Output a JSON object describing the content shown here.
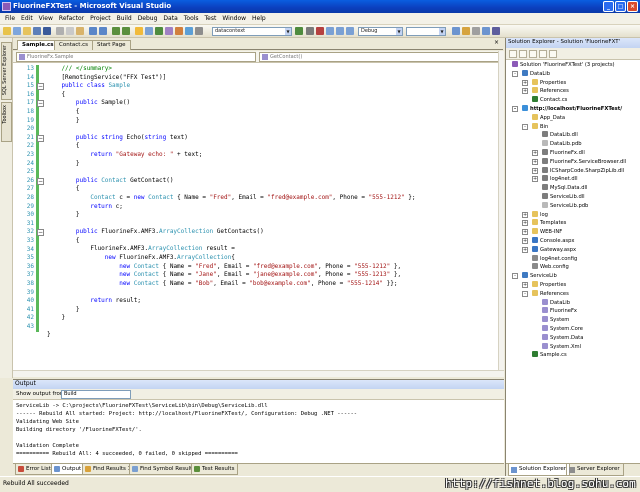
{
  "window": {
    "title": "FluorineFXTest - Microsoft Visual Studio"
  },
  "menu": [
    "File",
    "Edit",
    "View",
    "Refactor",
    "Project",
    "Build",
    "Debug",
    "Data",
    "Tools",
    "Test",
    "Window",
    "Help"
  ],
  "toolbar": {
    "combo1": "datacontext",
    "combo2": "Debug",
    "combo3": ""
  },
  "left_tabs": [
    "SQL Server Explorer",
    "Toolbox"
  ],
  "doc_tabs": [
    "Sample.cs",
    "Contact.cs",
    "Start Page"
  ],
  "nav": {
    "left": "FluorineFx.Sample",
    "right": "GetContact()"
  },
  "editor": {
    "line_numbers": [
      "13",
      "14",
      "15",
      "16",
      "17",
      "18",
      "19",
      "20",
      "21",
      "22",
      "23",
      "24",
      "25",
      "26",
      "27",
      "28",
      "29",
      "30",
      "31",
      "32",
      "33",
      "34",
      "35",
      "36",
      "37",
      "38",
      "39",
      "40",
      "41",
      "42",
      "43"
    ],
    "lines": [
      [
        {
          "t": "    /// </summary>",
          "c": "cm"
        }
      ],
      [
        {
          "t": "    [RemotingService(\"FFX Test\")]",
          "c": ""
        }
      ],
      [
        {
          "t": "    public ",
          "c": "kw"
        },
        {
          "t": "class ",
          "c": "kw"
        },
        {
          "t": "Sample",
          "c": "ty"
        }
      ],
      [
        {
          "t": "    {",
          "c": ""
        }
      ],
      [
        {
          "t": "        public ",
          "c": "kw"
        },
        {
          "t": "Sample()",
          "c": ""
        }
      ],
      [
        {
          "t": "        {",
          "c": ""
        }
      ],
      [
        {
          "t": "        }",
          "c": ""
        }
      ],
      [
        {
          "t": "",
          "c": ""
        }
      ],
      [
        {
          "t": "        public ",
          "c": "kw"
        },
        {
          "t": "string ",
          "c": "kw"
        },
        {
          "t": "Echo(",
          "c": ""
        },
        {
          "t": "string ",
          "c": "kw"
        },
        {
          "t": "text)",
          "c": ""
        }
      ],
      [
        {
          "t": "        {",
          "c": ""
        }
      ],
      [
        {
          "t": "            return ",
          "c": "kw"
        },
        {
          "t": "\"Gateway echo: \"",
          "c": "str"
        },
        {
          "t": " + text;",
          "c": ""
        }
      ],
      [
        {
          "t": "        }",
          "c": ""
        }
      ],
      [
        {
          "t": "",
          "c": ""
        }
      ],
      [
        {
          "t": "        public ",
          "c": "kw"
        },
        {
          "t": "Contact ",
          "c": "ty"
        },
        {
          "t": "GetContact()",
          "c": ""
        }
      ],
      [
        {
          "t": "        {",
          "c": ""
        }
      ],
      [
        {
          "t": "            Contact ",
          "c": "ty"
        },
        {
          "t": "c = ",
          "c": ""
        },
        {
          "t": "new ",
          "c": "kw"
        },
        {
          "t": "Contact ",
          "c": "ty"
        },
        {
          "t": "{ Name = ",
          "c": ""
        },
        {
          "t": "\"Fred\"",
          "c": "str"
        },
        {
          "t": ", Email = ",
          "c": ""
        },
        {
          "t": "\"fred@example.com\"",
          "c": "str"
        },
        {
          "t": ", Phone = ",
          "c": ""
        },
        {
          "t": "\"555-1212\"",
          "c": "str"
        },
        {
          "t": " };",
          "c": ""
        }
      ],
      [
        {
          "t": "            return ",
          "c": "kw"
        },
        {
          "t": "c;",
          "c": ""
        }
      ],
      [
        {
          "t": "        }",
          "c": ""
        }
      ],
      [
        {
          "t": "",
          "c": ""
        }
      ],
      [
        {
          "t": "        public ",
          "c": "kw"
        },
        {
          "t": "FluorineFx.AMF3.",
          "c": ""
        },
        {
          "t": "ArrayCollection ",
          "c": "ty"
        },
        {
          "t": "GetContacts()",
          "c": ""
        }
      ],
      [
        {
          "t": "        {",
          "c": ""
        }
      ],
      [
        {
          "t": "            FluorineFx.AMF3.",
          "c": ""
        },
        {
          "t": "ArrayCollection ",
          "c": "ty"
        },
        {
          "t": "result =",
          "c": ""
        }
      ],
      [
        {
          "t": "                new ",
          "c": "kw"
        },
        {
          "t": "FluorineFx.AMF3.",
          "c": ""
        },
        {
          "t": "ArrayCollection",
          "c": "ty"
        },
        {
          "t": "{",
          "c": ""
        }
      ],
      [
        {
          "t": "                    new ",
          "c": "kw"
        },
        {
          "t": "Contact ",
          "c": "ty"
        },
        {
          "t": "{ Name = ",
          "c": ""
        },
        {
          "t": "\"Fred\"",
          "c": "str"
        },
        {
          "t": ", Email = ",
          "c": ""
        },
        {
          "t": "\"fred@example.com\"",
          "c": "str"
        },
        {
          "t": ", Phone = ",
          "c": ""
        },
        {
          "t": "\"555-1212\"",
          "c": "str"
        },
        {
          "t": " },",
          "c": ""
        }
      ],
      [
        {
          "t": "                    new ",
          "c": "kw"
        },
        {
          "t": "Contact ",
          "c": "ty"
        },
        {
          "t": "{ Name = ",
          "c": ""
        },
        {
          "t": "\"Jane\"",
          "c": "str"
        },
        {
          "t": ", Email = ",
          "c": ""
        },
        {
          "t": "\"jane@example.com\"",
          "c": "str"
        },
        {
          "t": ", Phone = ",
          "c": ""
        },
        {
          "t": "\"555-1213\"",
          "c": "str"
        },
        {
          "t": " },",
          "c": ""
        }
      ],
      [
        {
          "t": "                    new ",
          "c": "kw"
        },
        {
          "t": "Contact ",
          "c": "ty"
        },
        {
          "t": "{ Name = ",
          "c": ""
        },
        {
          "t": "\"Bob\"",
          "c": "str"
        },
        {
          "t": ", Email = ",
          "c": ""
        },
        {
          "t": "\"bob@example.com\"",
          "c": "str"
        },
        {
          "t": ", Phone = ",
          "c": ""
        },
        {
          "t": "\"555-1214\"",
          "c": "str"
        },
        {
          "t": " }};",
          "c": ""
        }
      ],
      [
        {
          "t": "",
          "c": ""
        }
      ],
      [
        {
          "t": "            return ",
          "c": "kw"
        },
        {
          "t": "result;",
          "c": ""
        }
      ],
      [
        {
          "t": "        }",
          "c": ""
        }
      ],
      [
        {
          "t": "    }",
          "c": ""
        }
      ],
      [
        {
          "t": "",
          "c": ""
        }
      ],
      [
        {
          "t": "}",
          "c": ""
        }
      ]
    ]
  },
  "output": {
    "title": "Output",
    "show_label": "Show output from:",
    "show_value": "Build",
    "lines": [
      "ServiceLib -> C:\\projects\\FluorineFXTest\\ServiceLib\\bin\\Debug\\ServiceLib.dll",
      "------ Rebuild All started: Project: http://localhost/FluorineFXTest/, Configuration: Debug .NET ------",
      "Validating Web Site",
      "Building directory '/FluorineFXTest/'.",
      "",
      "Validation Complete",
      "========== Rebuild All: 4 succeeded, 0 failed, 0 skipped =========="
    ]
  },
  "bottom_tabs": [
    "Error List",
    "Output",
    "Find Results 1",
    "Find Symbol Results",
    "Test Results"
  ],
  "status": {
    "text": "Rebuild All succeeded"
  },
  "watermark": "http://fishnet.blog.sohu.com",
  "solution_explorer": {
    "title": "Solution Explorer - Solution 'FluorineFXT'",
    "tree": [
      {
        "label": "Solution 'FluorineFXTest' (3 projects)",
        "indent": 0,
        "icon": "solution",
        "bold": false,
        "exp": ""
      },
      {
        "label": "DataLib",
        "indent": 1,
        "icon": "project",
        "bold": false,
        "exp": "-"
      },
      {
        "label": "Properties",
        "indent": 2,
        "icon": "folder",
        "bold": false,
        "exp": "+"
      },
      {
        "label": "References",
        "indent": 2,
        "icon": "folder",
        "bold": false,
        "exp": "+"
      },
      {
        "label": "Contact.cs",
        "indent": 2,
        "icon": "cs",
        "bold": false,
        "exp": ""
      },
      {
        "label": "http://localhost/FluorineFXTest/",
        "indent": 1,
        "icon": "web",
        "bold": true,
        "exp": "-"
      },
      {
        "label": "App_Data",
        "indent": 2,
        "icon": "folder",
        "bold": false,
        "exp": ""
      },
      {
        "label": "Bin",
        "indent": 2,
        "icon": "folder",
        "bold": false,
        "exp": "-"
      },
      {
        "label": "DataLib.dll",
        "indent": 3,
        "icon": "dll",
        "bold": false,
        "exp": ""
      },
      {
        "label": "DataLib.pdb",
        "indent": 3,
        "icon": "file",
        "bold": false,
        "exp": ""
      },
      {
        "label": "FluorineFx.dll",
        "indent": 3,
        "icon": "dll",
        "bold": false,
        "exp": "+"
      },
      {
        "label": "FluorineFx.ServiceBrowser.dll",
        "indent": 3,
        "icon": "dll",
        "bold": false,
        "exp": "+"
      },
      {
        "label": "ICSharpCode.SharpZipLib.dll",
        "indent": 3,
        "icon": "dll",
        "bold": false,
        "exp": "+"
      },
      {
        "label": "log4net.dll",
        "indent": 3,
        "icon": "dll",
        "bold": false,
        "exp": "+"
      },
      {
        "label": "MySql.Data.dll",
        "indent": 3,
        "icon": "dll",
        "bold": false,
        "exp": ""
      },
      {
        "label": "ServiceLib.dll",
        "indent": 3,
        "icon": "dll",
        "bold": false,
        "exp": ""
      },
      {
        "label": "ServiceLib.pdb",
        "indent": 3,
        "icon": "file",
        "bold": false,
        "exp": ""
      },
      {
        "label": "log",
        "indent": 2,
        "icon": "folder",
        "bold": false,
        "exp": "+"
      },
      {
        "label": "Templates",
        "indent": 2,
        "icon": "folder",
        "bold": false,
        "exp": "+"
      },
      {
        "label": "WEB-INF",
        "indent": 2,
        "icon": "folder",
        "bold": false,
        "exp": "+"
      },
      {
        "label": "Console.aspx",
        "indent": 2,
        "icon": "aspx",
        "bold": false,
        "exp": "+"
      },
      {
        "label": "Gateway.aspx",
        "indent": 2,
        "icon": "aspx",
        "bold": false,
        "exp": "+"
      },
      {
        "label": "log4net.config",
        "indent": 2,
        "icon": "config",
        "bold": false,
        "exp": ""
      },
      {
        "label": "Web.config",
        "indent": 2,
        "icon": "config",
        "bold": false,
        "exp": ""
      },
      {
        "label": "ServiceLib",
        "indent": 1,
        "icon": "project",
        "bold": false,
        "exp": "-"
      },
      {
        "label": "Properties",
        "indent": 2,
        "icon": "folder",
        "bold": false,
        "exp": "+"
      },
      {
        "label": "References",
        "indent": 2,
        "icon": "folder",
        "bold": false,
        "exp": "-"
      },
      {
        "label": "DataLib",
        "indent": 3,
        "icon": "ref",
        "bold": false,
        "exp": ""
      },
      {
        "label": "FluorineFx",
        "indent": 3,
        "icon": "ref",
        "bold": false,
        "exp": ""
      },
      {
        "label": "System",
        "indent": 3,
        "icon": "ref",
        "bold": false,
        "exp": ""
      },
      {
        "label": "System.Core",
        "indent": 3,
        "icon": "ref",
        "bold": false,
        "exp": ""
      },
      {
        "label": "System.Data",
        "indent": 3,
        "icon": "ref",
        "bold": false,
        "exp": ""
      },
      {
        "label": "System.Xml",
        "indent": 3,
        "icon": "ref",
        "bold": false,
        "exp": ""
      },
      {
        "label": "Sample.cs",
        "indent": 2,
        "icon": "cs",
        "bold": false,
        "exp": ""
      }
    ],
    "tabs": [
      "Solution Explorer",
      "Server Explorer"
    ]
  },
  "colors": {
    "keyword": "#0000ff",
    "type": "#2b91af",
    "string": "#a31515",
    "comment": "#008000",
    "titlebar": "#0b3fbe",
    "selection": "#316ac5"
  }
}
